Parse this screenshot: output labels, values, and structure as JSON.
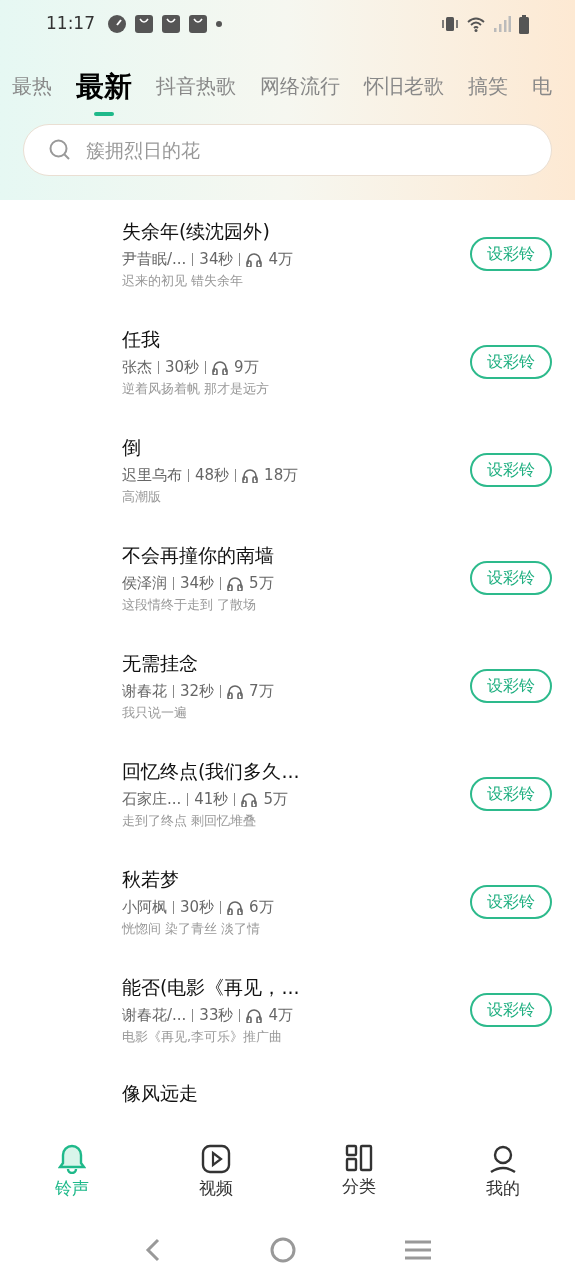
{
  "status_bar": {
    "time": "11:17"
  },
  "tabs": [
    {
      "label": "最热",
      "selected": false
    },
    {
      "label": "最新",
      "selected": true
    },
    {
      "label": "抖音热歌",
      "selected": false
    },
    {
      "label": "网络流行",
      "selected": false
    },
    {
      "label": "怀旧老歌",
      "selected": false
    },
    {
      "label": "搞笑",
      "selected": false
    },
    {
      "label": "电",
      "selected": false
    }
  ],
  "search": {
    "placeholder": "簇拥烈日的花"
  },
  "songs": [
    {
      "title": "失余年(续沈园外)",
      "artist": "尹昔眠/...",
      "duration": "34秒",
      "plays": "4万",
      "description": "迟来的初见 错失余年",
      "button": "设彩铃"
    },
    {
      "title": "任我",
      "artist": "张杰",
      "duration": "30秒",
      "plays": "9万",
      "description": "逆着风扬着帆 那才是远方",
      "button": "设彩铃"
    },
    {
      "title": "倒",
      "artist": "迟里乌布",
      "duration": "48秒",
      "plays": "18万",
      "description": "高潮版",
      "button": "设彩铃"
    },
    {
      "title": "不会再撞你的南墙",
      "artist": "侯泽润",
      "duration": "34秒",
      "plays": "5万",
      "description": "这段情终于走到 了散场",
      "button": "设彩铃"
    },
    {
      "title": "无需挂念",
      "artist": "谢春花",
      "duration": "32秒",
      "plays": "7万",
      "description": "我只说一遍",
      "button": "设彩铃"
    },
    {
      "title": "回忆终点(我们多久...",
      "artist": "石家庄...",
      "duration": "41秒",
      "plays": "5万",
      "description": "走到了终点 剩回忆堆叠",
      "button": "设彩铃"
    },
    {
      "title": "秋若梦",
      "artist": "小阿枫",
      "duration": "30秒",
      "plays": "6万",
      "description": "恍惚间 染了青丝 淡了情",
      "button": "设彩铃"
    },
    {
      "title": "能否(电影《再见，...",
      "artist": "谢春花/...",
      "duration": "33秒",
      "plays": "4万",
      "description": "电影《再见,李可乐》推广曲",
      "button": "设彩铃"
    },
    {
      "title": "像风远走"
    }
  ],
  "bottom_nav": [
    {
      "label": "铃声",
      "selected": true
    },
    {
      "label": "视频",
      "selected": false
    },
    {
      "label": "分类",
      "selected": false
    },
    {
      "label": "我的",
      "selected": false
    }
  ]
}
